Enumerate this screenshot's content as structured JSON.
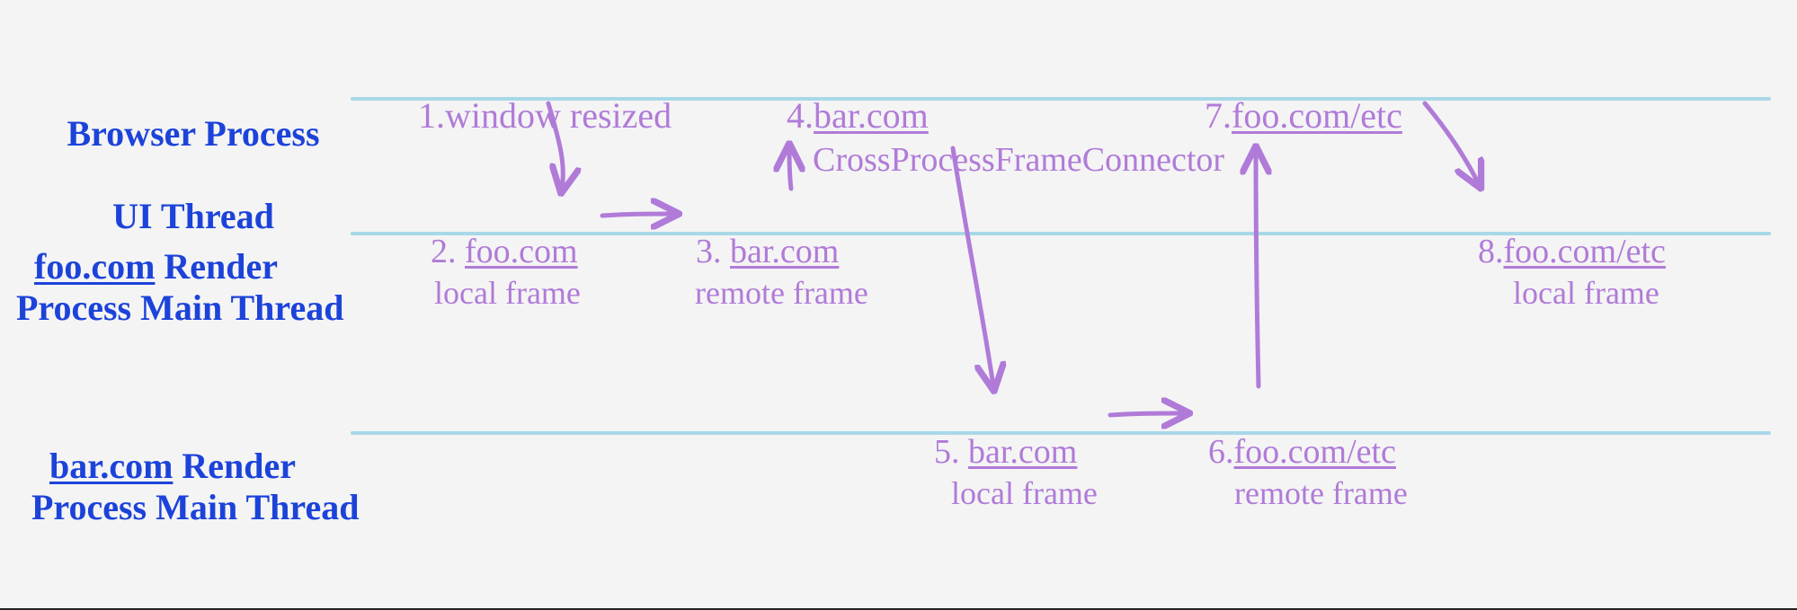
{
  "lanes": {
    "browser": {
      "label_line1": "Browser Process",
      "label_line2": "UI Thread"
    },
    "foo": {
      "label_prefix": "foo.com",
      "label_line1_suffix": " Render",
      "label_line2": "Process Main Thread"
    },
    "bar": {
      "label_prefix": "bar.com",
      "label_line1_suffix": " Render",
      "label_line2": "Process Main Thread"
    }
  },
  "steps": {
    "s1": {
      "num": "1.",
      "text": "window resized"
    },
    "s2": {
      "num": "2.",
      "link": "foo.com",
      "sub": "local frame"
    },
    "s3": {
      "num": "3.",
      "link": "bar.com",
      "sub": "remote frame"
    },
    "s4": {
      "num": "4.",
      "link": "bar.com",
      "sub": "CrossProcessFrameConnector"
    },
    "s5": {
      "num": "5.",
      "link": "bar.com",
      "sub": "local frame"
    },
    "s6": {
      "num": "6.",
      "link": "foo.com/etc",
      "sub": "remote frame"
    },
    "s7": {
      "num": "7.",
      "link": "foo.com/etc"
    },
    "s8": {
      "num": "8.",
      "link": "foo.com/etc",
      "sub": "local frame"
    }
  },
  "colors": {
    "lane_label": "#1c43d9",
    "event": "#b07bd8",
    "lane_line": "#a8d8e8"
  }
}
